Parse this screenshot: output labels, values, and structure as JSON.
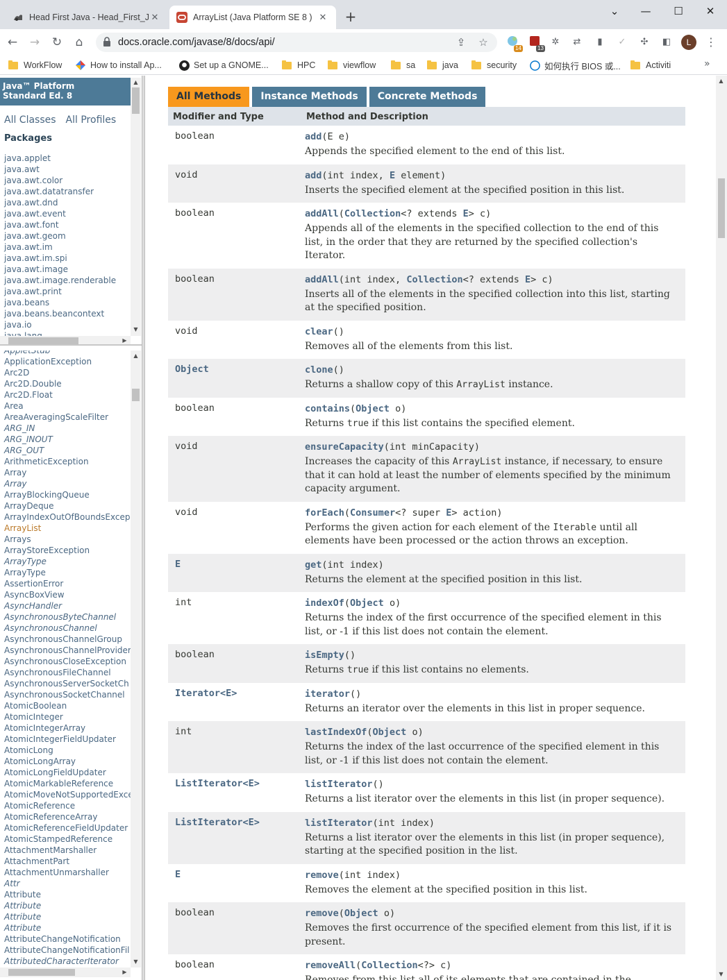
{
  "browser": {
    "tabs": [
      {
        "title": "Head First Java - Head_First_Ja"
      },
      {
        "title": "ArrayList (Java Platform SE 8 )"
      }
    ],
    "url": "docs.oracle.com/javase/8/docs/api/",
    "avatar_letter": "L",
    "ext_badges": [
      "14",
      "13"
    ],
    "bookmarks": [
      {
        "label": "WorkFlow",
        "icon": "folder-icon"
      },
      {
        "label": "How to install Ap...",
        "icon": "colorful-diamond-icon"
      },
      {
        "label": "Set up a GNOME...",
        "icon": "github-icon"
      },
      {
        "label": "HPC",
        "icon": "folder-icon"
      },
      {
        "label": "viewflow",
        "icon": "folder-icon"
      },
      {
        "label": "sa",
        "icon": "folder-icon"
      },
      {
        "label": "java",
        "icon": "folder-icon"
      },
      {
        "label": "security",
        "icon": "folder-icon"
      },
      {
        "label": "如何执行 BIOS 或...",
        "icon": "dell-icon"
      },
      {
        "label": "Activiti",
        "icon": "folder-icon"
      }
    ]
  },
  "left": {
    "platform_line1": "Java™ Platform",
    "platform_line2": "Standard Ed. 8",
    "all_classes": "All Classes",
    "all_profiles": "All Profiles",
    "packages_heading": "Packages",
    "packages": [
      "java.applet",
      "java.awt",
      "java.awt.color",
      "java.awt.datatransfer",
      "java.awt.dnd",
      "java.awt.event",
      "java.awt.font",
      "java.awt.geom",
      "java.awt.im",
      "java.awt.im.spi",
      "java.awt.image",
      "java.awt.image.renderable",
      "java.awt.print",
      "java.beans",
      "java.beans.beancontext",
      "java.io",
      "java.lang"
    ],
    "classes": [
      {
        "n": "AppletStub",
        "i": true
      },
      {
        "n": "ApplicationException"
      },
      {
        "n": "Arc2D"
      },
      {
        "n": "Arc2D.Double"
      },
      {
        "n": "Arc2D.Float"
      },
      {
        "n": "Area"
      },
      {
        "n": "AreaAveragingScaleFilter"
      },
      {
        "n": "ARG_IN",
        "i": true
      },
      {
        "n": "ARG_INOUT",
        "i": true
      },
      {
        "n": "ARG_OUT",
        "i": true
      },
      {
        "n": "ArithmeticException"
      },
      {
        "n": "Array"
      },
      {
        "n": "Array",
        "i": true
      },
      {
        "n": "ArrayBlockingQueue"
      },
      {
        "n": "ArrayDeque"
      },
      {
        "n": "ArrayIndexOutOfBoundsExcep"
      },
      {
        "n": "ArrayList",
        "c": true
      },
      {
        "n": "Arrays"
      },
      {
        "n": "ArrayStoreException"
      },
      {
        "n": "ArrayType",
        "i": true
      },
      {
        "n": "ArrayType"
      },
      {
        "n": "AssertionError"
      },
      {
        "n": "AsyncBoxView"
      },
      {
        "n": "AsyncHandler",
        "i": true
      },
      {
        "n": "AsynchronousByteChannel",
        "i": true
      },
      {
        "n": "AsynchronousChannel",
        "i": true
      },
      {
        "n": "AsynchronousChannelGroup"
      },
      {
        "n": "AsynchronousChannelProvider"
      },
      {
        "n": "AsynchronousCloseException"
      },
      {
        "n": "AsynchronousFileChannel"
      },
      {
        "n": "AsynchronousServerSocketCh"
      },
      {
        "n": "AsynchronousSocketChannel"
      },
      {
        "n": "AtomicBoolean"
      },
      {
        "n": "AtomicInteger"
      },
      {
        "n": "AtomicIntegerArray"
      },
      {
        "n": "AtomicIntegerFieldUpdater"
      },
      {
        "n": "AtomicLong"
      },
      {
        "n": "AtomicLongArray"
      },
      {
        "n": "AtomicLongFieldUpdater"
      },
      {
        "n": "AtomicMarkableReference"
      },
      {
        "n": "AtomicMoveNotSupportedExce"
      },
      {
        "n": "AtomicReference"
      },
      {
        "n": "AtomicReferenceArray"
      },
      {
        "n": "AtomicReferenceFieldUpdater"
      },
      {
        "n": "AtomicStampedReference"
      },
      {
        "n": "AttachmentMarshaller"
      },
      {
        "n": "AttachmentPart"
      },
      {
        "n": "AttachmentUnmarshaller"
      },
      {
        "n": "Attr",
        "i": true
      },
      {
        "n": "Attribute"
      },
      {
        "n": "Attribute",
        "i": true
      },
      {
        "n": "Attribute",
        "i": true
      },
      {
        "n": "Attribute",
        "i": true
      },
      {
        "n": "AttributeChangeNotification"
      },
      {
        "n": "AttributeChangeNotificationFil"
      },
      {
        "n": "AttributedCharacterIterator",
        "i": true
      }
    ]
  },
  "content": {
    "tabs": [
      "All Methods",
      "Instance Methods",
      "Concrete Methods"
    ],
    "header_type": "Modifier and Type",
    "header_method": "Method and Description",
    "methods": [
      {
        "type": [
          "boolean"
        ],
        "name": "add",
        "params": [
          [
            "(E e)"
          ]
        ],
        "desc": [
          [
            "Appends the specified element to the end of this list."
          ]
        ]
      },
      {
        "type": [
          "void"
        ],
        "name": "add",
        "params": [
          [
            "(int index, "
          ],
          [
            "E",
            "t"
          ],
          [
            " element)"
          ]
        ],
        "desc": [
          [
            "Inserts the specified element at the specified position in this list."
          ]
        ]
      },
      {
        "type": [
          "boolean"
        ],
        "name": "addAll",
        "params": [
          [
            "("
          ],
          [
            "Collection",
            "t"
          ],
          [
            "<? extends "
          ],
          [
            "E",
            "t"
          ],
          [
            "> c)"
          ]
        ],
        "desc": [
          [
            "Appends all of the elements in the specified collection to the end of this list, in the order that they are returned by the specified collection's Iterator."
          ]
        ]
      },
      {
        "type": [
          "boolean"
        ],
        "name": "addAll",
        "params": [
          [
            "(int index, "
          ],
          [
            "Collection",
            "t"
          ],
          [
            "<? extends "
          ],
          [
            "E",
            "t"
          ],
          [
            "> c)"
          ]
        ],
        "desc": [
          [
            "Inserts all of the elements in the specified collection into this list, starting at the specified position."
          ]
        ]
      },
      {
        "type": [
          "void"
        ],
        "name": "clear",
        "params": [
          [
            "()"
          ]
        ],
        "desc": [
          [
            "Removes all of the elements from this list."
          ]
        ]
      },
      {
        "type": [
          "Object",
          "l"
        ],
        "name": "clone",
        "params": [
          [
            "()"
          ]
        ],
        "desc": [
          [
            "Returns a shallow copy of this "
          ],
          [
            "ArrayList",
            "c"
          ],
          [
            " instance."
          ]
        ]
      },
      {
        "type": [
          "boolean"
        ],
        "name": "contains",
        "params": [
          [
            "("
          ],
          [
            "Object",
            "t"
          ],
          [
            " o)"
          ]
        ],
        "desc": [
          [
            "Returns "
          ],
          [
            "true",
            "c"
          ],
          [
            " if this list contains the specified element."
          ]
        ]
      },
      {
        "type": [
          "void"
        ],
        "name": "ensureCapacity",
        "params": [
          [
            "(int minCapacity)"
          ]
        ],
        "desc": [
          [
            "Increases the capacity of this "
          ],
          [
            "ArrayList",
            "c"
          ],
          [
            " instance, if necessary, to ensure that it can hold at least the number of elements specified by the minimum capacity argument."
          ]
        ]
      },
      {
        "type": [
          "void"
        ],
        "name": "forEach",
        "params": [
          [
            "("
          ],
          [
            "Consumer",
            "t"
          ],
          [
            "<? super "
          ],
          [
            "E",
            "t"
          ],
          [
            "> action)"
          ]
        ],
        "desc": [
          [
            "Performs the given action for each element of the "
          ],
          [
            "Iterable",
            "c"
          ],
          [
            " until all elements have been processed or the action throws an exception."
          ]
        ]
      },
      {
        "type": [
          "E",
          "l"
        ],
        "name": "get",
        "params": [
          [
            "(int index)"
          ]
        ],
        "desc": [
          [
            "Returns the element at the specified position in this list."
          ]
        ]
      },
      {
        "type": [
          "int"
        ],
        "name": "indexOf",
        "params": [
          [
            "("
          ],
          [
            "Object",
            "t"
          ],
          [
            " o)"
          ]
        ],
        "desc": [
          [
            "Returns the index of the first occurrence of the specified element in this list, or -1 if this list does not contain the element."
          ]
        ]
      },
      {
        "type": [
          "boolean"
        ],
        "name": "isEmpty",
        "params": [
          [
            "()"
          ]
        ],
        "desc": [
          [
            "Returns "
          ],
          [
            "true",
            "c"
          ],
          [
            " if this list contains no elements."
          ]
        ]
      },
      {
        "type": [
          "Iterator<E>",
          "l"
        ],
        "name": "iterator",
        "params": [
          [
            "()"
          ]
        ],
        "desc": [
          [
            "Returns an iterator over the elements in this list in proper sequence."
          ]
        ]
      },
      {
        "type": [
          "int"
        ],
        "name": "lastIndexOf",
        "params": [
          [
            "("
          ],
          [
            "Object",
            "t"
          ],
          [
            " o)"
          ]
        ],
        "desc": [
          [
            "Returns the index of the last occurrence of the specified element in this list, or -1 if this list does not contain the element."
          ]
        ]
      },
      {
        "type": [
          "ListIterator<E>",
          "l"
        ],
        "name": "listIterator",
        "params": [
          [
            "()"
          ]
        ],
        "desc": [
          [
            "Returns a list iterator over the elements in this list (in proper sequence)."
          ]
        ]
      },
      {
        "type": [
          "ListIterator<E>",
          "l"
        ],
        "name": "listIterator",
        "params": [
          [
            "(int index)"
          ]
        ],
        "desc": [
          [
            "Returns a list iterator over the elements in this list (in proper sequence), starting at the specified position in the list."
          ]
        ]
      },
      {
        "type": [
          "E",
          "l"
        ],
        "name": "remove",
        "params": [
          [
            "(int index)"
          ]
        ],
        "desc": [
          [
            "Removes the element at the specified position in this list."
          ]
        ]
      },
      {
        "type": [
          "boolean"
        ],
        "name": "remove",
        "params": [
          [
            "("
          ],
          [
            "Object",
            "t"
          ],
          [
            " o)"
          ]
        ],
        "desc": [
          [
            "Removes the first occurrence of the specified element from this list, if it is present."
          ]
        ]
      },
      {
        "type": [
          "boolean"
        ],
        "name": "removeAll",
        "params": [
          [
            "("
          ],
          [
            "Collection",
            "t"
          ],
          [
            "<?> c)"
          ]
        ],
        "desc": [
          [
            "Removes from this list all of its elements that are contained in the specified collection."
          ]
        ]
      }
    ]
  },
  "colors": {
    "accent": "#f8981d",
    "nav_blue": "#4d7a97",
    "link": "#4a6782",
    "row_alt": "#eeeeef",
    "header_bg": "#dee3e9"
  }
}
